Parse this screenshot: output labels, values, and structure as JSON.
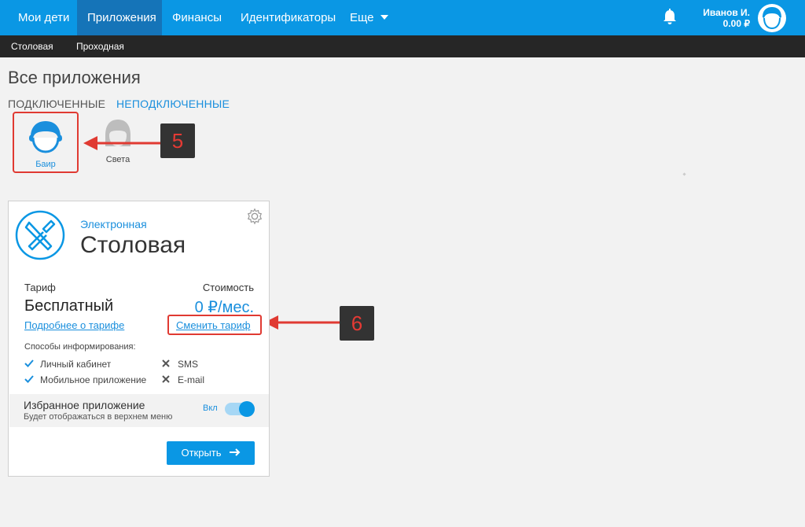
{
  "nav": {
    "items": [
      {
        "label": "Мои дети"
      },
      {
        "label": "Приложения"
      },
      {
        "label": "Финансы"
      },
      {
        "label": "Идентификаторы"
      },
      {
        "label": "Еще"
      }
    ],
    "user": {
      "name": "Иванов И.",
      "balance": "0.00 ₽"
    }
  },
  "subnav": {
    "items": [
      {
        "label": "Столовая"
      },
      {
        "label": "Проходная"
      }
    ]
  },
  "page": {
    "title": "Все приложения"
  },
  "tabs": {
    "connected": "ПОДКЛЮЧЕННЫЕ",
    "not_connected": "НЕПОДКЛЮЧЕННЫЕ"
  },
  "children": [
    {
      "name": "Баир"
    },
    {
      "name": "Света"
    }
  ],
  "annotations": {
    "step5": "5",
    "step6": "6"
  },
  "card": {
    "subtitle": "Электронная",
    "title": "Столовая",
    "tariff_label": "Тариф",
    "cost_label": "Стоимость",
    "tariff_value": "Бесплатный",
    "cost_value": "0 ₽/мес.",
    "more_link": "Подробнее о тарифе",
    "change_link": "Сменить тариф",
    "notify_label": "Способы информирования:",
    "methods": [
      {
        "label": "Личный кабинет",
        "enabled": true
      },
      {
        "label": "SMS",
        "enabled": false
      },
      {
        "label": "Мобильное приложение",
        "enabled": true
      },
      {
        "label": "E-mail",
        "enabled": false
      }
    ],
    "favorite": {
      "title": "Избранное приложение",
      "desc": "Будет отображаться в верхнем меню",
      "toggle_label": "Вкл",
      "on": true
    },
    "open_button": "Открыть"
  },
  "colors": {
    "primary": "#0a97e4",
    "nav_active": "#1574b8",
    "subnav": "#262626",
    "highlight": "#e03a32",
    "link": "#1a8fdd"
  },
  "icons": [
    "bell-icon",
    "avatar-icon",
    "gear-icon",
    "cutlery-icon",
    "check-icon",
    "cross-icon",
    "arrow-right-icon"
  ]
}
